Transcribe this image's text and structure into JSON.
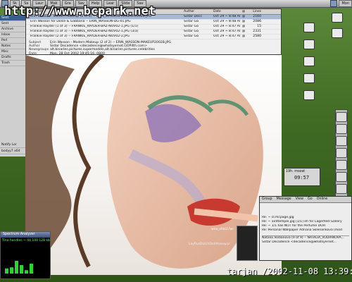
{
  "watermark": "http://www.bcpark.net",
  "topbar": {
    "items": [
      "Sk",
      "Sa",
      "Laur",
      "Mak",
      "Gra",
      "Sav",
      "Help",
      "Lear",
      "Slide",
      "Sav"
    ],
    "clock": "Mon"
  },
  "leftpanel": {
    "title": "Sent",
    "rows": [
      "Sent",
      "Archive",
      "Inbox",
      "Perl",
      "Notes",
      "Misc",
      "Drafts",
      "Trash"
    ],
    "footer": "Notify Lor",
    "status": "bodyy7 x64"
  },
  "mail": {
    "columns": {
      "subject": "Subject",
      "author": "Author",
      "date": "Date",
      "flag": "@",
      "size": "Lines"
    },
    "rows": [
      {
        "subject": "Erin Wasson - Modern Makeup (2 of 2) -- ERIN_WASSON-MAKEUP2002B.JPG",
        "author": "Sistar Decc",
        "date": "Oct 29 ~ 8:48 AM",
        "flag": "@",
        "size": "2160",
        "sel": true
      },
      {
        "subject": "Erin Wasson for Dolce & Gabbana -- ERIN_WASSON-DG-01.JPG",
        "author": "Sistar Go",
        "date": "Oct 29 ~ 8:48 AM",
        "flag": "@",
        "size": "2086",
        "sel": false
      },
      {
        "subject": "Frankie Rayder (1 of 3) -- FRANKIE_RAYDER-BAZ-NOV02-1.JPG (1/1)",
        "author": "Sistar Go",
        "date": "Oct 29 ~ 8:47 AM",
        "flag": "@",
        "size": "15",
        "sel": false
      },
      {
        "subject": "Frankie Rayder (1 of 3) -- FRANKIE_RAYDER-BAZ-NOV02-1.JPG (3/3)",
        "author": "Sistar Go",
        "date": "Oct 29 ~ 8:47 AM",
        "flag": "@",
        "size": "2331",
        "sel": false
      },
      {
        "subject": "Frankie Rayder (2 of 3) -- FRANKIE_RAYDER-BAZ-NOV02-2.JPG",
        "author": "Sistar Go",
        "date": "Oct 29 ~ 8:47 AM",
        "flag": "@",
        "size": "2580",
        "sel": false
      }
    ],
    "meta": [
      {
        "k": "Subject",
        "v": "Erin Wasson - Modern Makeup (2 of 2) -- ERIN_WASSON-MAKEUP2002B.JPG"
      },
      {
        "k": "Author",
        "v": "Sistar Decadence <decadence@whatsyernet.GOP4th.com>"
      },
      {
        "k": "Newsgroups",
        "v": "alt.binaries.pictures.supermodels,alt.binaries.pictures.celebrities"
      },
      {
        "k": "Date",
        "v": "Mon, 28 Oct 2002 19:45:16 -0800"
      }
    ]
  },
  "clockbox": {
    "label": "19h. mozat",
    "time": "09:57"
  },
  "mail2": {
    "tabs": [
      "Group",
      "Message",
      "View",
      "Go",
      "Online"
    ],
    "rows": [
      "Re: ~ cl.mcpage.jpg",
      "Re: ~ airdtempel.jpg [1/1] eh for Lagerfeld Gallery",
      "Re: ~ 1/1 has NOT for the Perfume DOH",
      "Re: Personal Wallpaper Adriana Sklenarikova (mod"
    ],
    "preview": "Natalia Vodianova (9 of 9) -- NATALIA_VODIANOVA...",
    "preview2": "Sistar Decadence <decadence@whatsyernet..."
  },
  "spectrum": {
    "title": "Spectrum Analyzer",
    "track": "Tina handles ~ 44.100 128 kbit (00:10 mod)",
    "levels": [
      0.18,
      0.22,
      0.45,
      0.3,
      0.12,
      0.35
    ]
  },
  "xmms": {
    "label": "wno_shts2.fwr"
  },
  "desk_label": "LayflusDutchDoll#lasay.pr",
  "footer": "tarjan /2002-11-08 13:39:28",
  "colors": {
    "selection": "#a8b8d8",
    "desktop": "#4e7a2e",
    "panel": "#cfcfcf"
  }
}
